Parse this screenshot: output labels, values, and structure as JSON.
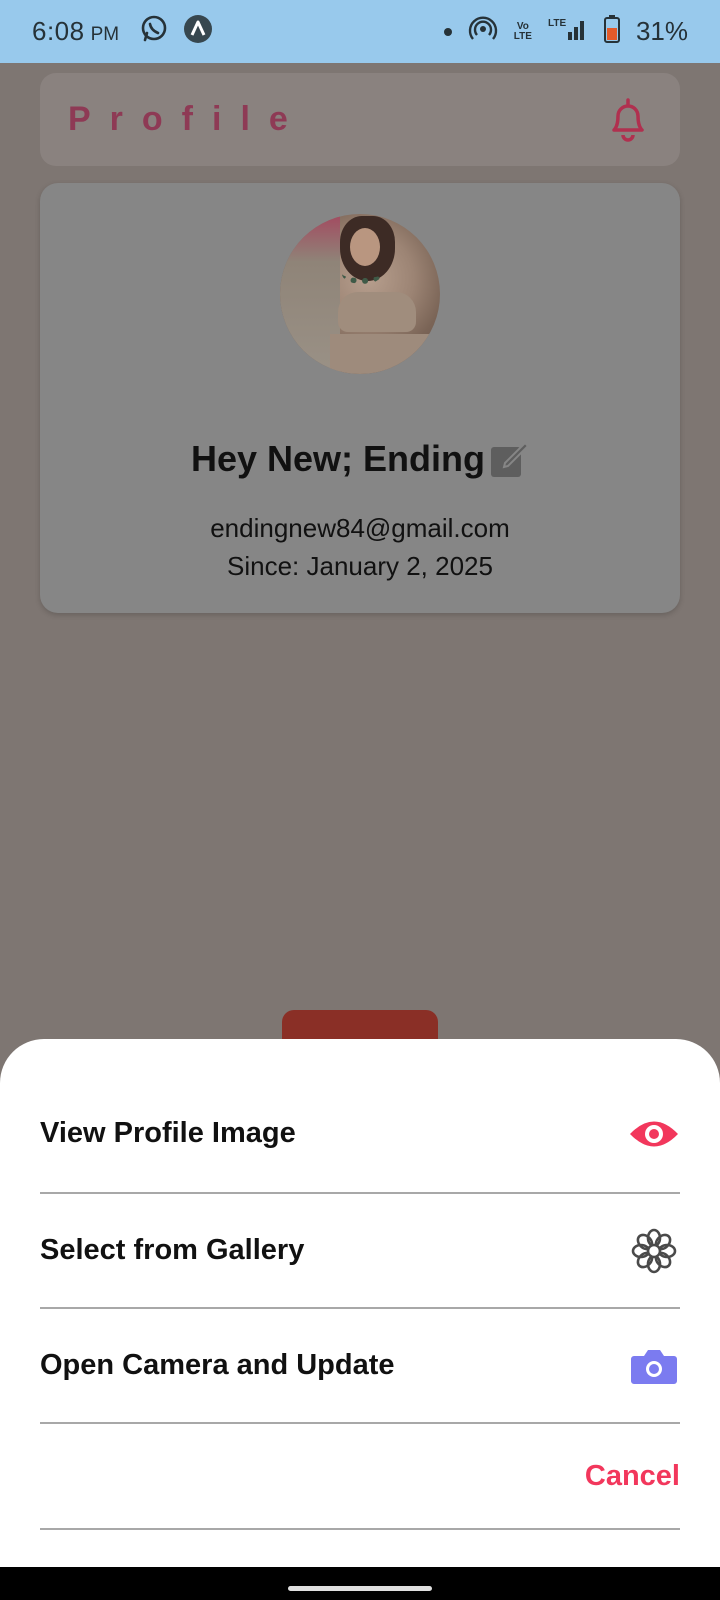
{
  "status_bar": {
    "time": "6:08",
    "ampm": "PM",
    "battery_percent": "31%",
    "network_label": "LTE",
    "icons": [
      "whatsapp-icon",
      "app-notification-icon",
      "dot-icon",
      "hotspot-icon",
      "volte-icon",
      "signal-icon",
      "battery-icon"
    ]
  },
  "header": {
    "title": "Profile",
    "bell_icon": "bell-icon",
    "accent_color": "#8e3a55"
  },
  "profile": {
    "name": "Hey New; Ending",
    "email": "endingnew84@gmail.com",
    "since": "Since: January 2, 2025",
    "edit_icon": "edit-icon"
  },
  "sheet": {
    "items": [
      {
        "label": "View Profile Image",
        "icon": "eye-icon",
        "icon_color": "#f2375c"
      },
      {
        "label": "Select from Gallery",
        "icon": "flower-icon",
        "icon_color": "#4a4a4a"
      },
      {
        "label": "Open Camera and Update",
        "icon": "camera-icon",
        "icon_color": "#7b7bf0"
      }
    ],
    "cancel_label": "Cancel",
    "cancel_color": "#f2375c"
  }
}
